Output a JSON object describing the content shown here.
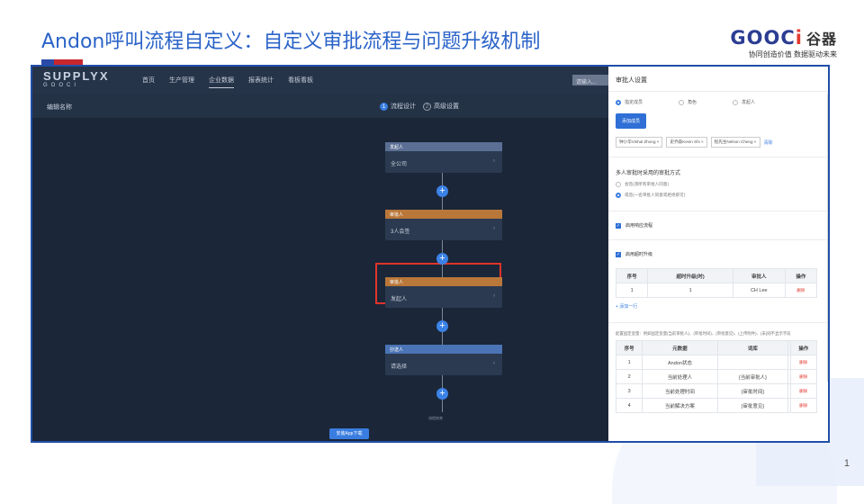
{
  "slide": {
    "title": "Andon呼叫流程自定义：自定义审批流程与问题升级机制",
    "brand_logo_main": "GOOC",
    "brand_logo_i": "i",
    "brand_logo_cn": "谷器",
    "brand_tagline": "协同创造价值 数据驱动未来",
    "page_number": "1"
  },
  "app": {
    "logo_top": "SUPPLYX",
    "logo_sub": "GOOCI",
    "nav": [
      "首页",
      "生产管理",
      "企业数据",
      "报表统计",
      "看板看板"
    ],
    "search_placeholder": "请输入..."
  },
  "flow": {
    "name_label": "编辑名称",
    "step1_num": "1",
    "step1_label": "流程设计",
    "step2_num": "2",
    "step2_label": "高级设置",
    "nodes": [
      {
        "head": "发起人",
        "body": "全公司"
      },
      {
        "head": "审批人",
        "body": "3人会签"
      },
      {
        "head": "审批人",
        "body": "发起人"
      },
      {
        "head": "抄送人",
        "body": "请选择"
      }
    ],
    "chevron": "›",
    "plus": "+",
    "end_label": "流程结束",
    "app_download": "安装App下载"
  },
  "panel": {
    "title": "审批人设置",
    "radio_options": [
      "指定成员",
      "角色",
      "发起人"
    ],
    "add_member_button": "添加成员",
    "tags": [
      "钟小华Vishal Zhong ×",
      "史乔森Kevin Shi ×",
      "程先生Nelson Cheng ×"
    ],
    "clear_label": "清除",
    "method_title": "多人审批时采用的审批方式",
    "method_options": [
      "会签(须所有审批人同意)",
      "或签(一名审批人同意或拒绝即可)"
    ],
    "check_label_1": "启用响应流程",
    "check_label_2": "启用超时升级",
    "check_mark": "✓",
    "escalation_table": {
      "headers": [
        "序号",
        "超时升级(时)",
        "审批人",
        "操作"
      ],
      "rows": [
        [
          "1",
          "1",
          "CH Lee",
          "删除"
        ]
      ]
    },
    "add_row_label": "+ 添加一行",
    "note": "配置固定变量：例如固定变量(当前审批人)、(审批时间)、(审批意见)、(上传附件)、(未)则不显示字段",
    "meta_table": {
      "headers": [
        "序号",
        "元数据",
        "词库",
        "",
        "操作"
      ],
      "rows": [
        [
          "1",
          "Andon状态",
          "",
          "",
          "删除"
        ],
        [
          "2",
          "当前处理人",
          "{当前审批人}",
          "",
          "删除"
        ],
        [
          "3",
          "当前处理时间",
          "{审批时间}",
          "",
          "删除"
        ],
        [
          "4",
          "当前解决方案",
          "{审批意见}",
          "",
          "删除"
        ]
      ]
    }
  },
  "colors": {
    "title_blue": "#2a63c8",
    "highlight_red": "#e0342a",
    "approve_orange": "#b9773a",
    "primary_blue": "#2f6fd6"
  }
}
